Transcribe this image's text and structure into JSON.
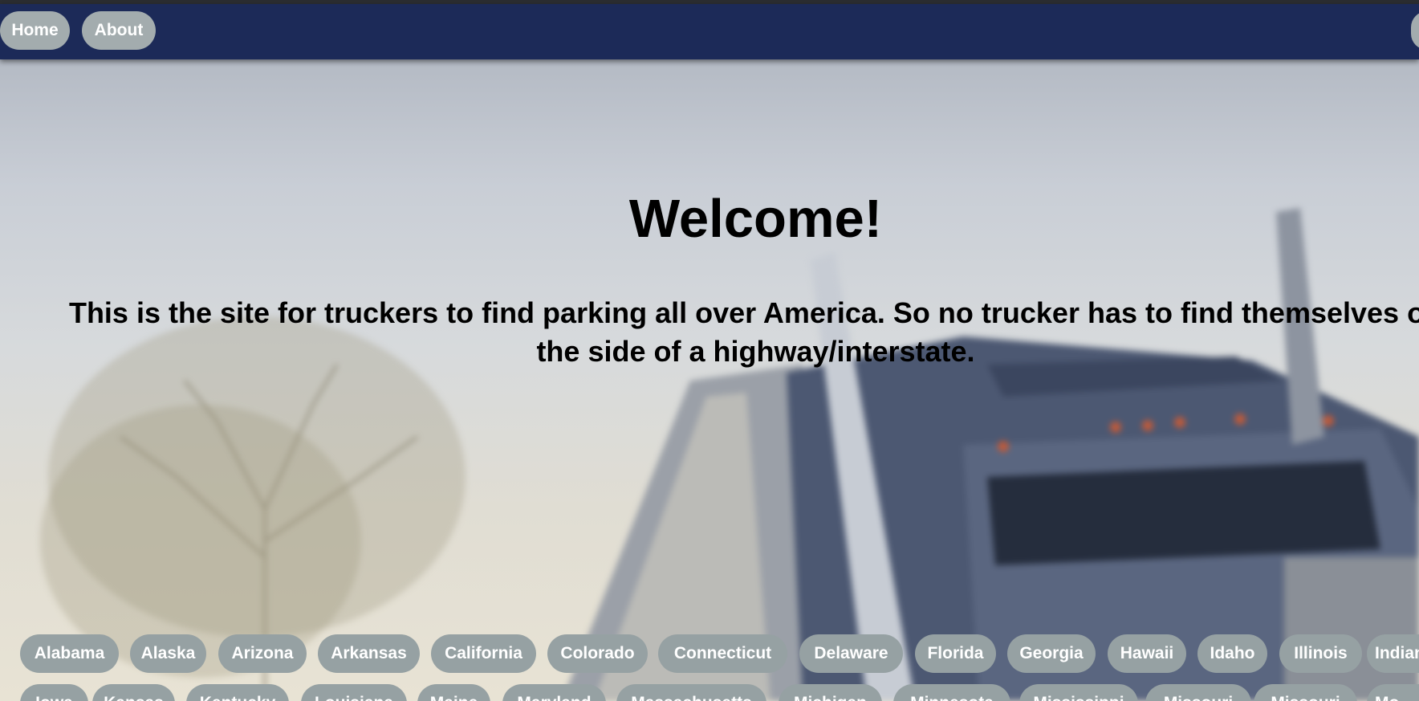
{
  "nav": {
    "home_label": "Home",
    "about_label": "About"
  },
  "hero": {
    "title": "Welcome!",
    "subtitle": "This is the site for truckers to find parking all over America. So no trucker has to find themselves on the side of a highway/interstate."
  },
  "states_row1": [
    "Alabama",
    "Alaska",
    "Arizona",
    "Arkansas",
    "California",
    "Colorado",
    "Connecticut",
    "Delaware",
    "Florida",
    "Georgia",
    "Hawaii",
    "Idaho",
    "Illinois",
    "Indiana"
  ],
  "states_row2": [
    "Iowa",
    "Kansas",
    "Kentucky",
    "Louisiana",
    "Maine",
    "Maryland",
    "Massachusetts",
    "Michigan",
    "Minnesota",
    "Mississippi",
    "Missouri",
    "Missouri",
    "Mo"
  ],
  "colors": {
    "navbar": "#1c2a58",
    "pill": "#96a1a3",
    "pill_text": "#ffffff"
  }
}
